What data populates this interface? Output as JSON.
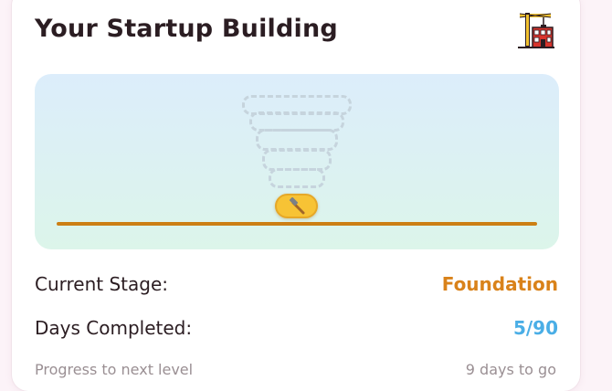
{
  "card": {
    "title": "Your Startup Building",
    "header_icon": "construction-building-icon"
  },
  "scene": {
    "builder_icon": "hammer-icon",
    "floors_planned_icon": "dashed-floor-outline",
    "colors": {
      "ground": "#cc7f14",
      "pill": "#f7c335"
    }
  },
  "stats": {
    "stage_label": "Current Stage:",
    "stage_value": "Foundation",
    "stage_color": "#d9821a",
    "days_label": "Days Completed:",
    "days_value": "5/90",
    "days_color": "#4aaee6"
  },
  "progress": {
    "label": "Progress to next level",
    "remaining": "9 days to go"
  }
}
